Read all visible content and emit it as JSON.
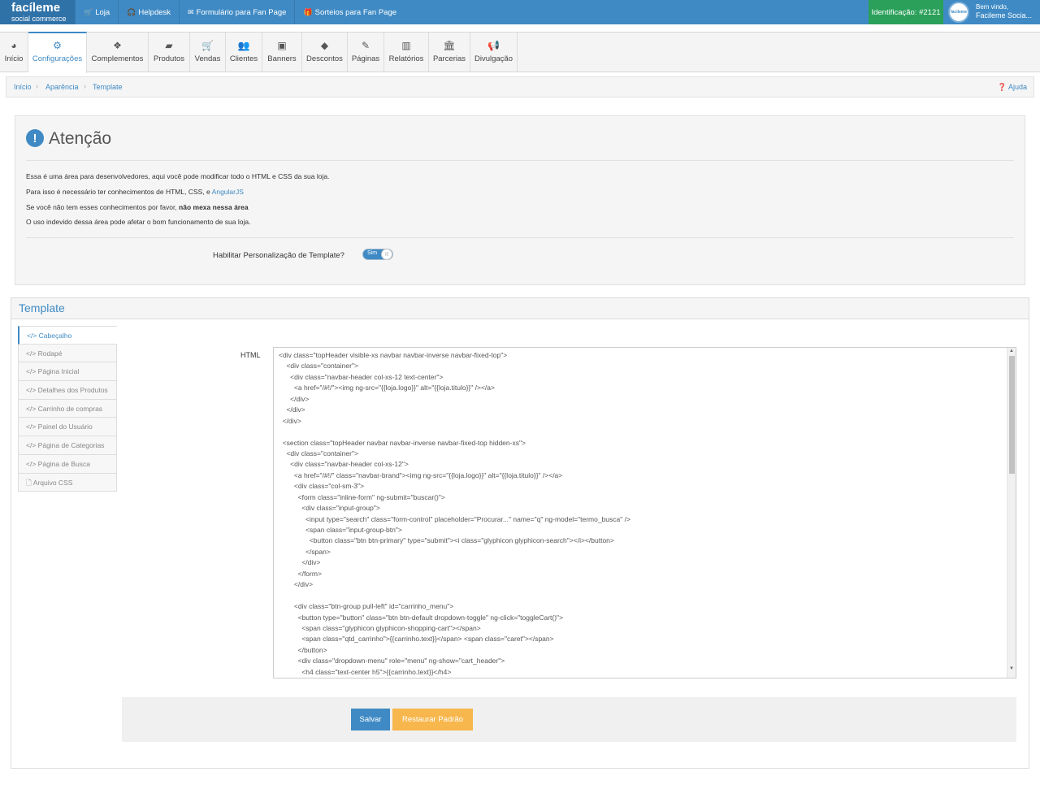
{
  "topbar": {
    "brand_line1": "facíleme",
    "brand_line2": "social commerce",
    "items": [
      {
        "icon": "cart-icon",
        "glyph": "🛒",
        "label": "Loja"
      },
      {
        "icon": "headphones-icon",
        "glyph": "🎧",
        "label": "Helpdesk"
      },
      {
        "icon": "envelope-icon",
        "glyph": "✉",
        "label": "Formulário para Fan Page"
      },
      {
        "icon": "gift-icon",
        "glyph": "🎁",
        "label": "Sorteios para Fan Page"
      }
    ],
    "identification": "Identificação: #2121",
    "user_greeting": "Bem vindo,",
    "user_name": "Facileme Socia...",
    "avatar_text": "facileme"
  },
  "modules": [
    {
      "label": "Início",
      "icon": "dashboard-icon",
      "glyph": "◕"
    },
    {
      "label": "Configurações",
      "icon": "cogs-icon",
      "glyph": "⚙"
    },
    {
      "label": "Complementos",
      "icon": "cubes-icon",
      "glyph": "❖"
    },
    {
      "label": "Produtos",
      "icon": "folder-icon",
      "glyph": "▰"
    },
    {
      "label": "Vendas",
      "icon": "cart-icon",
      "glyph": "🛒"
    },
    {
      "label": "Clientes",
      "icon": "users-icon",
      "glyph": "👥"
    },
    {
      "label": "Banners",
      "icon": "picture-icon",
      "glyph": "▣"
    },
    {
      "label": "Descontos",
      "icon": "tags-icon",
      "glyph": "◆"
    },
    {
      "label": "Páginas",
      "icon": "edit-icon",
      "glyph": "✎"
    },
    {
      "label": "Relatórios",
      "icon": "bar-chart-icon",
      "glyph": "▥"
    },
    {
      "label": "Parcerias",
      "icon": "bank-icon",
      "glyph": "🏛"
    },
    {
      "label": "Divulgação",
      "icon": "bullhorn-icon",
      "glyph": "📢"
    }
  ],
  "breadcrumb": {
    "items": [
      "Início",
      "Aparência",
      "Template"
    ],
    "help": "Ajuda"
  },
  "alert": {
    "title": "Atenção",
    "line1": "Essa é uma área para desenvolvedores, aqui você pode modificar todo o HTML e CSS da sua loja.",
    "line2_prefix": "Para isso é necessário ter conhecimentos de HTML, CSS, e ",
    "line2_link": "AngularJS",
    "line3_prefix": "Se você não tem esses conhecimentos por favor, ",
    "line3_bold": "não mexa nessa área",
    "line4": "O uso indevido dessa área pode afetar o bom funcionamento de sua loja.",
    "toggle_label": "Habilitar Personalização de Template?",
    "toggle_on_text": "Sim",
    "toggle_knob": "|||"
  },
  "template": {
    "title": "Template",
    "tabs": [
      {
        "label": "Cabeçalho",
        "icon": "code-icon",
        "glyph": "</>",
        "active": true
      },
      {
        "label": "Rodapé",
        "icon": "code-icon",
        "glyph": "</>"
      },
      {
        "label": "Página Inicial",
        "icon": "code-icon",
        "glyph": "</>"
      },
      {
        "label": "Detalhes dos Produtos",
        "icon": "code-icon",
        "glyph": "</>"
      },
      {
        "label": "Carrinho de compras",
        "icon": "code-icon",
        "glyph": "</>"
      },
      {
        "label": "Painel do Usuário",
        "icon": "code-icon",
        "glyph": "</>"
      },
      {
        "label": "Página de Categorias",
        "icon": "code-icon",
        "glyph": "</>"
      },
      {
        "label": "Página de Busca",
        "icon": "code-icon",
        "glyph": "</>"
      },
      {
        "label": "Arquivo CSS",
        "icon": "file-icon",
        "glyph": "🗋"
      }
    ],
    "html_label": "HTML",
    "code_lines": [
      "<div class=\"topHeader visible-xs navbar navbar-inverse navbar-fixed-top\">",
      "    <div class=\"container\">",
      "      <div class=\"navbar-header col-xs-12 text-center\">",
      "        <a href=\"/#!/\"><img ng-src=\"{{loja.logo}}\" alt=\"{{loja.titulo}}\" /></a>",
      "      </div>",
      "    </div>",
      "  </div>",
      "",
      "  <section class=\"topHeader navbar navbar-inverse navbar-fixed-top hidden-xs\">",
      "    <div class=\"container\">",
      "      <div class=\"navbar-header col-xs-12\">",
      "        <a href=\"/#!/\" class=\"navbar-brand\"><img ng-src=\"{{loja.logo}}\" alt=\"{{loja.titulo}}\" /></a>",
      "        <div class=\"col-sm-3\">",
      "          <form class=\"inline-form\" ng-submit=\"buscar()\">",
      "            <div class=\"input-group\">",
      "              <input type=\"search\" class=\"form-control\" placeholder=\"Procurar...\" name=\"q\" ng-model=\"termo_busca\" />",
      "              <span class=\"input-group-btn\">",
      "                <button class=\"btn btn-primary\" type=\"submit\"><i class=\"glyphicon glyphicon-search\"></i></button>",
      "              </span>",
      "            </div>",
      "          </form>",
      "        </div>",
      "",
      "        <div class=\"btn-group pull-left\" id=\"carrinho_menu\">",
      "          <button type=\"button\" class=\"btn btn-default dropdown-toggle\" ng-click=\"toggleCart()\">",
      "            <span class=\"glyphicon glyphicon-shopping-cart\"></span>",
      "            <span class=\"qtd_carrinho\">{{carrinho.text}}</span> <span class=\"caret\"></span>",
      "          </button>",
      "          <div class=\"dropdown-menu\" role=\"menu\" ng-show=\"cart_header\">",
      "            <h4 class=\"text-center h5\">{{carrinho.text}}</h4>"
    ],
    "save_label": "Salvar",
    "restore_label": "Restaurar Padrão"
  },
  "colors": {
    "brand_blue": "#3f8ac4",
    "ident_green": "#2aa05a",
    "restore_orange": "#f7b74d"
  }
}
